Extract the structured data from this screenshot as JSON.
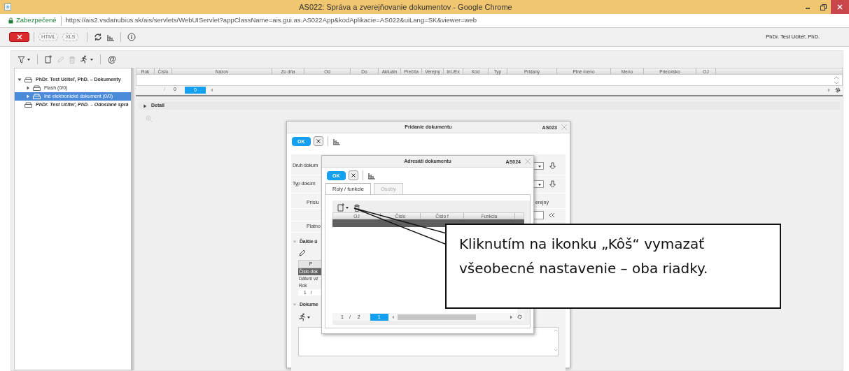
{
  "window": {
    "title": "AS022: Správa a zverejňovanie dokumentov - Google Chrome"
  },
  "address_bar": {
    "security": "Zabezpečené",
    "url": "https://ais2.vsdanubius.sk/ais/servlets/WebUIServlet?appClassName=ais.gui.as.AS022App&kodAplikacie=AS022&uiLang=SK&viewer=web"
  },
  "app_toolbar": [
    [
      {
        "kind": "close",
        "disabled": false
      }
    ],
    [
      {
        "kind": "text",
        "label": "HTML",
        "disabled": true
      },
      {
        "kind": "text",
        "label": "XLS",
        "disabled": true
      }
    ],
    [
      {
        "kind": "refresh",
        "disabled": false
      },
      {
        "kind": "chart",
        "disabled": false
      }
    ],
    [
      {
        "kind": "info",
        "disabled": false
      }
    ]
  ],
  "user": "PhDr. Test Učiteľ, PhD.",
  "toolbar": [
    [
      {
        "kind": "filter",
        "disabled": false,
        "dropdown": true
      }
    ],
    [
      {
        "kind": "new_document",
        "disabled": false,
        "dropdown": false
      },
      {
        "kind": "edit",
        "disabled": true,
        "dropdown": false
      },
      {
        "kind": "delete",
        "disabled": true,
        "dropdown": false
      },
      {
        "kind": "run",
        "disabled": false,
        "dropdown": true
      }
    ],
    [
      {
        "kind": "text",
        "label": "@",
        "disabled": false
      }
    ]
  ],
  "tree": [
    {
      "label": "PhDr. Test Učiteľ, PhD. – Dokumenty",
      "kind": "folder",
      "expanded": true,
      "selected": false,
      "children": [
        {
          "label": "Flash (0/0)",
          "kind": "folder",
          "expanded": false,
          "selected": false
        },
        {
          "label": "Iné elektronické dokument (0/0)",
          "kind": "folder",
          "expanded": false,
          "selected": true
        }
      ]
    },
    {
      "label": "PhDr. Test Učiteľ, PhD. – Odoslané sprá",
      "kind": "sent"
    }
  ],
  "grid": {
    "columns": [
      "Rok",
      "Číslo",
      "Názov",
      "Zo dňa",
      "Od",
      "Do",
      "Aktuáln",
      "Prečíta",
      "Verejný",
      "Int./Ex",
      "Kód",
      "Typ",
      "Pridaný",
      "Plné meno",
      "Meno",
      "Priezvisko",
      "OJ"
    ],
    "pager": {
      "slash": "/",
      "total": "0",
      "page": "0"
    }
  },
  "detail": {
    "label": "Detail",
    "expanded": false
  },
  "dialog_add": {
    "title": "Pridanie dokumentu",
    "code": "AS023",
    "ok": "OK",
    "fields": [
      {
        "label": "Druh dokum",
        "kind": "select"
      },
      {
        "label": "Typ dokum",
        "kind": "select"
      },
      {
        "label": "Príslu",
        "kind": "right_label",
        "right": "erejný"
      },
      {
        "kind": "input"
      },
      {
        "label": "Platno",
        "kind": "plain"
      }
    ],
    "section_more": {
      "label": "Ďalšie ú",
      "expanded": true,
      "header": "P",
      "rows": [
        {
          "label": "Číslo dok",
          "selected": true
        },
        {
          "label": "Dátum vz",
          "selected": false
        },
        {
          "label": "Rok",
          "selected": false
        }
      ],
      "pager": {
        "page": "1",
        "slash": "/"
      }
    },
    "section_doc": {
      "label": "Dokume",
      "expanded": true
    }
  },
  "dialog_recipients": {
    "title": "Adresáti dokumentu",
    "code": "AS024",
    "ok": "OK",
    "tabs": [
      {
        "label": "Roly / funkcie",
        "selected": true
      },
      {
        "label": "Osoby",
        "selected": false
      }
    ],
    "columns": [
      "OJ",
      "Číslo",
      "Číslo f",
      "Funkcia"
    ],
    "rows": [
      {
        "selected": true
      },
      {
        "selected": false
      }
    ],
    "pager": {
      "page": "1",
      "slash": "/",
      "total": "2",
      "current": "1"
    }
  },
  "callout": {
    "text": "Kliknutím na ikonku „Kôš“ vymazať všeobecné nastavenie – oba riadky."
  }
}
